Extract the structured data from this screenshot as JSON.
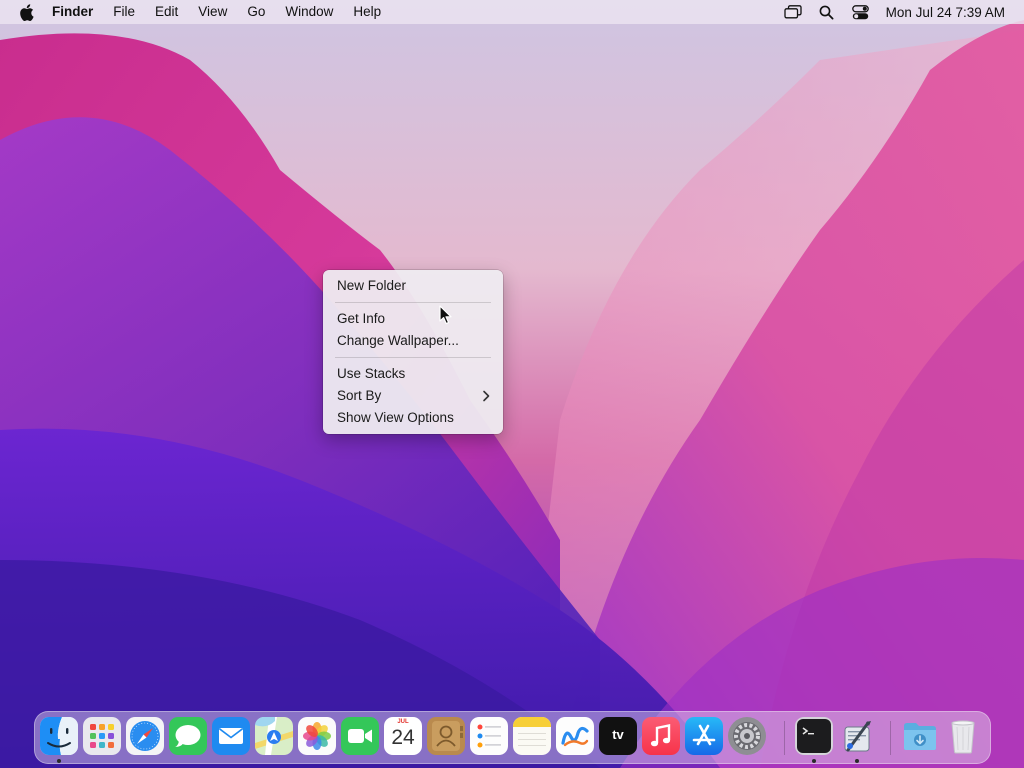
{
  "menubar": {
    "apple_icon": "apple-logo-icon",
    "app_name": "Finder",
    "menus": [
      "File",
      "Edit",
      "View",
      "Go",
      "Window",
      "Help"
    ],
    "status_icons": [
      "screen-mirroring-icon",
      "spotlight-search-icon",
      "control-center-icon"
    ],
    "clock": "Mon Jul 24  7:39 AM"
  },
  "context_menu": {
    "items": [
      "New Folder",
      "Get Info",
      "Change Wallpaper...",
      "Use Stacks",
      "Sort By",
      "Show View Options"
    ],
    "submenu_icon": "chevron-right-icon"
  },
  "dock": {
    "apps": [
      {
        "name": "Finder",
        "icon": "finder-icon",
        "running": true
      },
      {
        "name": "Launchpad",
        "icon": "launchpad-icon",
        "running": false
      },
      {
        "name": "Safari",
        "icon": "safari-icon",
        "running": false
      },
      {
        "name": "Messages",
        "icon": "messages-icon",
        "running": false
      },
      {
        "name": "Mail",
        "icon": "mail-icon",
        "running": false
      },
      {
        "name": "Maps",
        "icon": "maps-icon",
        "running": false
      },
      {
        "name": "Photos",
        "icon": "photos-icon",
        "running": false
      },
      {
        "name": "FaceTime",
        "icon": "facetime-icon",
        "running": false
      },
      {
        "name": "Calendar",
        "icon": "calendar-icon",
        "running": false
      },
      {
        "name": "Contacts",
        "icon": "contacts-icon",
        "running": false
      },
      {
        "name": "Reminders",
        "icon": "reminders-icon",
        "running": false
      },
      {
        "name": "Notes",
        "icon": "notes-icon",
        "running": false
      },
      {
        "name": "Freeform",
        "icon": "freeform-icon",
        "running": false
      },
      {
        "name": "TV",
        "icon": "apple-tv-icon",
        "running": false
      },
      {
        "name": "Music",
        "icon": "music-icon",
        "running": false
      },
      {
        "name": "App Store",
        "icon": "app-store-icon",
        "running": false
      },
      {
        "name": "System Settings",
        "icon": "system-settings-icon",
        "running": false
      },
      {
        "name": "Terminal",
        "icon": "terminal-icon",
        "running": true
      },
      {
        "name": "Script Editor",
        "icon": "script-editor-icon",
        "running": true
      },
      {
        "name": "Downloads",
        "icon": "downloads-folder-icon",
        "running": false
      },
      {
        "name": "Trash",
        "icon": "trash-icon",
        "running": false
      }
    ],
    "calendar": {
      "month": "JUL",
      "day": "24"
    },
    "tv_label": "tv"
  },
  "colors": {
    "wallpaper_top": "#d6c9e6",
    "wallpaper_pink": "#e0418f",
    "wallpaper_purple": "#6a22d6",
    "menubar_bg": "#ece4f0",
    "context_menu_bg": "#eeebf0"
  }
}
